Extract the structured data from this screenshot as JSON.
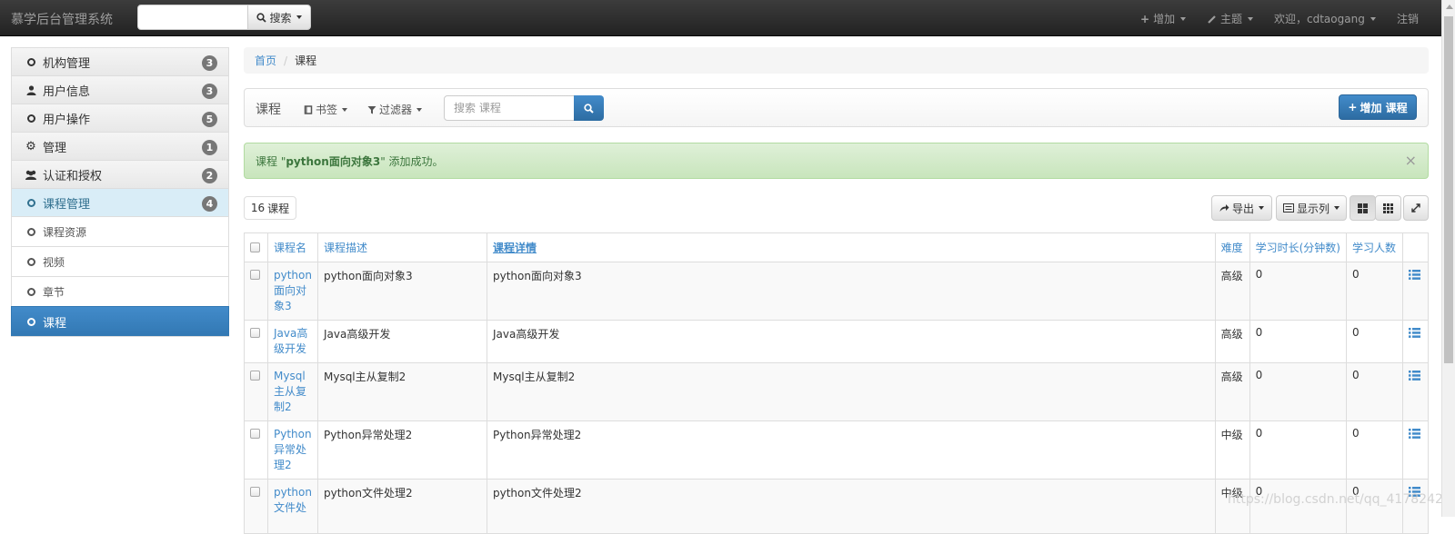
{
  "navbar": {
    "brand": "慕学后台管理系统",
    "search_button": "搜索",
    "add_menu": "增加",
    "theme_menu": "主题",
    "welcome": "欢迎，cdtaogang",
    "logout": "注销"
  },
  "sidebar": {
    "items": [
      {
        "label": "机构管理",
        "badge": "3",
        "icon": "circle-o-icon"
      },
      {
        "label": "用户信息",
        "badge": "3",
        "icon": "user-icon"
      },
      {
        "label": "用户操作",
        "badge": "5",
        "icon": "circle-o-icon"
      },
      {
        "label": "管理",
        "badge": "1",
        "icon": "gear-icon"
      },
      {
        "label": "认证和授权",
        "badge": "2",
        "icon": "users-icon"
      },
      {
        "label": "课程管理",
        "badge": "4",
        "icon": "circle-o-icon"
      }
    ],
    "subitems": [
      {
        "label": "课程资源"
      },
      {
        "label": "视频"
      },
      {
        "label": "章节"
      },
      {
        "label": "课程"
      }
    ]
  },
  "breadcrumb": {
    "home": "首页",
    "current": "课程"
  },
  "toolbar": {
    "title": "课程",
    "bookmarks": "书签",
    "filters": "过滤器",
    "search_placeholder": "搜索 课程",
    "add_button": "增加 课程"
  },
  "alert": {
    "prefix": "课程 \"",
    "name": "python面向对象3",
    "suffix": "\" 添加成功。",
    "close": "×"
  },
  "result": {
    "count": "16",
    "unit": "课程"
  },
  "actions": {
    "export": "导出",
    "columns": "显示列"
  },
  "table": {
    "headers": [
      "课程名",
      "课程描述",
      "课程详情",
      "难度",
      "学习时长(分钟数)",
      "学习人数"
    ],
    "rows": [
      {
        "name": "python面向对象3",
        "desc": "python面向对象3",
        "detail": "python面向对象3",
        "degree": "高级",
        "learn_times": "0",
        "students": "0"
      },
      {
        "name": "Java高级开发",
        "desc": "Java高级开发",
        "detail": "Java高级开发",
        "degree": "高级",
        "learn_times": "0",
        "students": "0"
      },
      {
        "name": "Mysql主从复制2",
        "desc": "Mysql主从复制2",
        "detail": "Mysql主从复制2",
        "degree": "高级",
        "learn_times": "0",
        "students": "0"
      },
      {
        "name": "Python异常处理2",
        "desc": "Python异常处理2",
        "detail": "Python异常处理2",
        "degree": "中级",
        "learn_times": "0",
        "students": "0"
      },
      {
        "name": "python文件处",
        "desc": "python文件处理2",
        "detail": "python文件处理2",
        "degree": "中级",
        "learn_times": "0",
        "students": "0"
      }
    ]
  },
  "watermark": "https://blog.csdn.net/qq_41782425",
  "colors": {
    "primary": "#428bca",
    "navbar": "#222222",
    "success_bg": "#dff0d8"
  }
}
